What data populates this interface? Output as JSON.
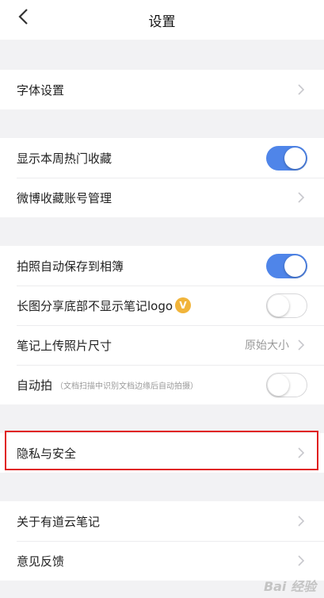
{
  "header": {
    "title": "设置"
  },
  "groups": {
    "font": {
      "items": [
        {
          "label": "字体设置"
        }
      ]
    },
    "collect": {
      "items": [
        {
          "label": "显示本周热门收藏",
          "toggle": true
        },
        {
          "label": "微博收藏账号管理"
        }
      ]
    },
    "photo": {
      "items": [
        {
          "label": "拍照自动保存到相簿",
          "toggle": true
        },
        {
          "label": "长图分享底部不显示笔记logo",
          "badge": "V",
          "toggle": false
        },
        {
          "label": "笔记上传照片尺寸",
          "value": "原始大小"
        },
        {
          "label": "自动拍",
          "sublabel": "（文档扫描中识别文档边缘后自动拍摄）",
          "toggle": false
        }
      ]
    },
    "privacy": {
      "items": [
        {
          "label": "隐私与安全"
        }
      ]
    },
    "about": {
      "items": [
        {
          "label": "关于有道云笔记"
        },
        {
          "label": "意见反馈"
        }
      ]
    }
  },
  "watermark": "Bai 经验",
  "colors": {
    "accent": "#4f85e9",
    "highlight": "#e01f1f",
    "badge": "#f1b43a"
  }
}
